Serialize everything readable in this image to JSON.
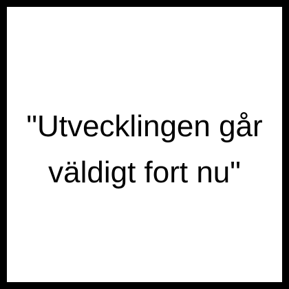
{
  "quote": {
    "line1": "\"Utvecklingen går",
    "line2": "väldigt fort nu\""
  },
  "colors": {
    "background": "#ffffff",
    "border": "#000000",
    "text": "#000000"
  }
}
